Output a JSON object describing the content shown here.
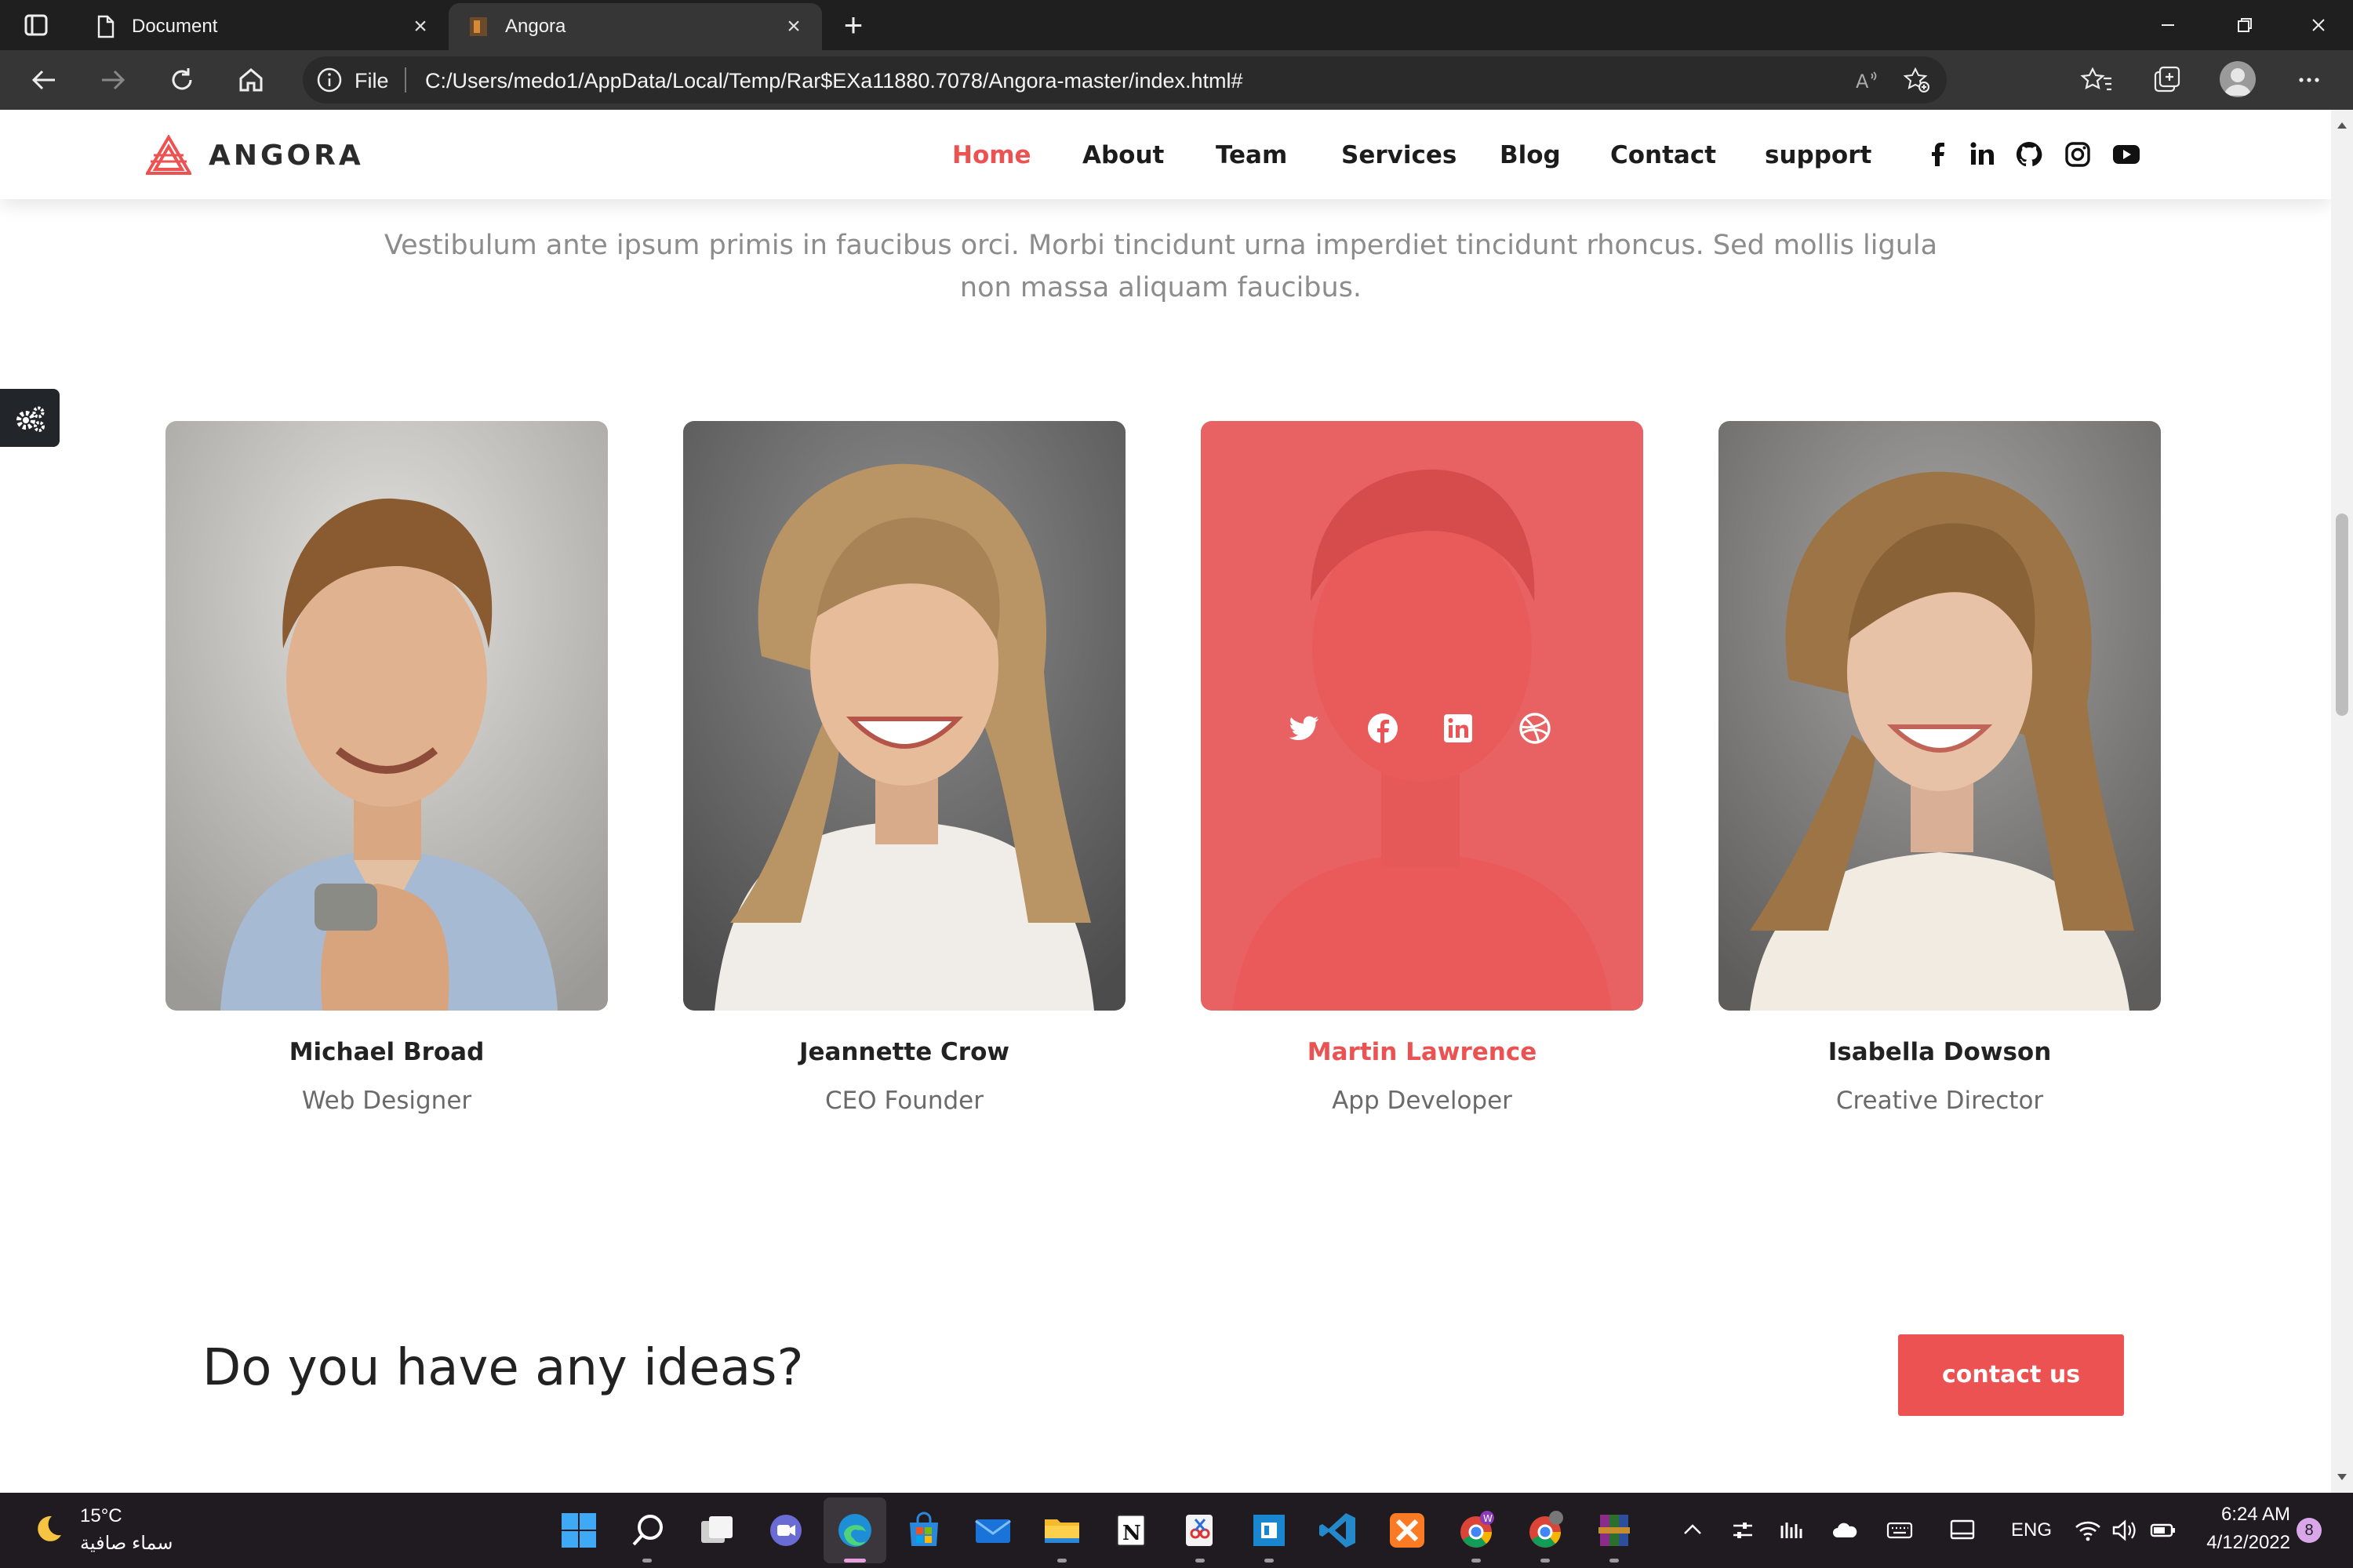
{
  "browser": {
    "tabs": [
      {
        "title": "Document",
        "active": false
      },
      {
        "title": "Angora",
        "active": true
      }
    ],
    "address": {
      "prefix": "File",
      "url": "C:/Users/medo1/AppData/Local/Temp/Rar$EXa11880.7078/Angora-master/index.html#"
    }
  },
  "site": {
    "logo_text": "ANGORA",
    "menu": [
      "Home",
      "About",
      "Team",
      "Services",
      "Blog",
      "Contact",
      "support"
    ],
    "active_menu": "Home",
    "social_icons": [
      "facebook-icon",
      "linkedin-icon",
      "github-icon",
      "instagram-icon",
      "youtube-icon"
    ],
    "accent_color": "#ec5252"
  },
  "team": {
    "intro": "Vestibulum ante ipsum primis in faucibus orci. Morbi tincidunt urna imperdiet tincidunt rhoncus. Sed mollis ligula non massa aliquam faucibus.",
    "members": [
      {
        "name": "Michael Broad",
        "role": "Web Designer"
      },
      {
        "name": "Jeannette Crow",
        "role": "CEO Founder"
      },
      {
        "name": "Martin Lawrence",
        "role": "App Developer",
        "hovered": true,
        "overlay_icons": [
          "twitter-icon",
          "facebook-icon",
          "linkedin-icon",
          "dribbble-icon"
        ]
      },
      {
        "name": "Isabella Dowson",
        "role": "Creative Director"
      }
    ]
  },
  "cta": {
    "heading": "Do you have any ideas?",
    "button": "contact us"
  },
  "taskbar": {
    "weather": {
      "temp": "15°C",
      "condition": "سماء صافية"
    },
    "language": "ENG",
    "time": "6:24 AM",
    "date": "4/12/2022",
    "notifications": "8"
  }
}
